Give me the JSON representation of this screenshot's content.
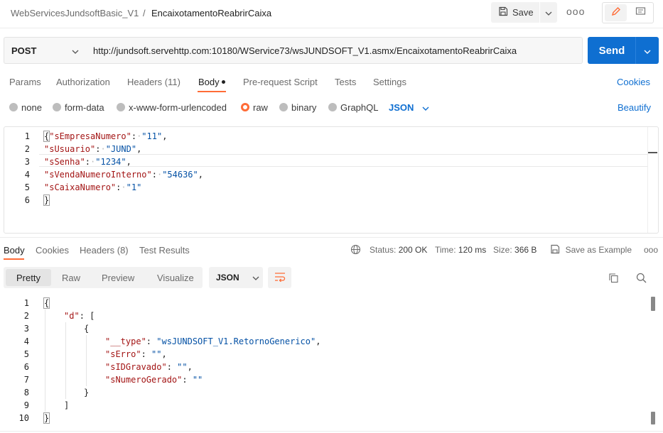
{
  "breadcrumb": {
    "collection": "WebServicesJundsoftBasic_V1",
    "separator": "/",
    "request": "EncaixotamentoReabrirCaixa"
  },
  "toolbar": {
    "save_label": "Save",
    "more_label": "ooo"
  },
  "request": {
    "method": "POST",
    "url": "http://jundsoft.servehttp.com:10180/WService73/wsJUNDSOFT_V1.asmx/EncaixotamentoReabrirCaixa",
    "send_label": "Send",
    "tabs": {
      "params": "Params",
      "authorization": "Authorization",
      "headers": "Headers (11)",
      "body": "Body",
      "prerequest": "Pre-request Script",
      "tests": "Tests",
      "settings": "Settings"
    },
    "cookies_label": "Cookies",
    "body_types": {
      "none": "none",
      "form_data": "form-data",
      "urlencoded": "x-www-form-urlencoded",
      "raw": "raw",
      "binary": "binary",
      "graphql": "GraphQL"
    },
    "selected_body_type": "raw",
    "format": "JSON",
    "beautify_label": "Beautify",
    "body_lines": [
      {
        "n": "1",
        "key": "\"sEmpresaNumero\"",
        "value": "\"11\"",
        "open": "{"
      },
      {
        "n": "2",
        "key": "\"sUsuario\"",
        "value": "\"JUND\""
      },
      {
        "n": "3",
        "key": "\"sSenha\"",
        "value": "\"1234\""
      },
      {
        "n": "4",
        "key": "\"sVendaNumeroInterno\"",
        "value": "\"54636\""
      },
      {
        "n": "5",
        "key": "\"sCaixaNumero\"",
        "value": "\"1\""
      },
      {
        "n": "6",
        "close": "}"
      }
    ]
  },
  "response": {
    "tabs": {
      "body": "Body",
      "cookies": "Cookies",
      "headers": "Headers (8)",
      "test_results": "Test Results"
    },
    "status": {
      "label": "Status:",
      "value": "200 OK"
    },
    "time": {
      "label": "Time:",
      "value": "120 ms"
    },
    "size": {
      "label": "Size:",
      "value": "366 B"
    },
    "save_example_label": "Save as Example",
    "more_label": "ooo",
    "views": {
      "pretty": "Pretty",
      "raw": "Raw",
      "preview": "Preview",
      "visualize": "Visualize"
    },
    "format": "JSON",
    "body_lines": {
      "l1": {
        "n": "1",
        "text": "{"
      },
      "l2": {
        "n": "2",
        "key": "\"d\"",
        "text": ": ["
      },
      "l3": {
        "n": "3",
        "text": "{"
      },
      "l4": {
        "n": "4",
        "key": "\"__type\"",
        "value": "\"wsJUNDSOFT_V1.RetornoGenerico\""
      },
      "l5": {
        "n": "5",
        "key": "\"sErro\"",
        "value": "\"\""
      },
      "l6": {
        "n": "6",
        "key": "\"sIDGravado\"",
        "value": "\"\""
      },
      "l7": {
        "n": "7",
        "key": "\"sNumeroGerado\"",
        "value": "\"\""
      },
      "l8": {
        "n": "8",
        "text": "}"
      },
      "l9": {
        "n": "9",
        "text": "]"
      },
      "l10": {
        "n": "10",
        "text": "}"
      }
    }
  },
  "colors": {
    "accent": "#ff6c37",
    "primary": "#0f6fd1",
    "json_key": "#a31515",
    "json_string": "#0451a5"
  }
}
